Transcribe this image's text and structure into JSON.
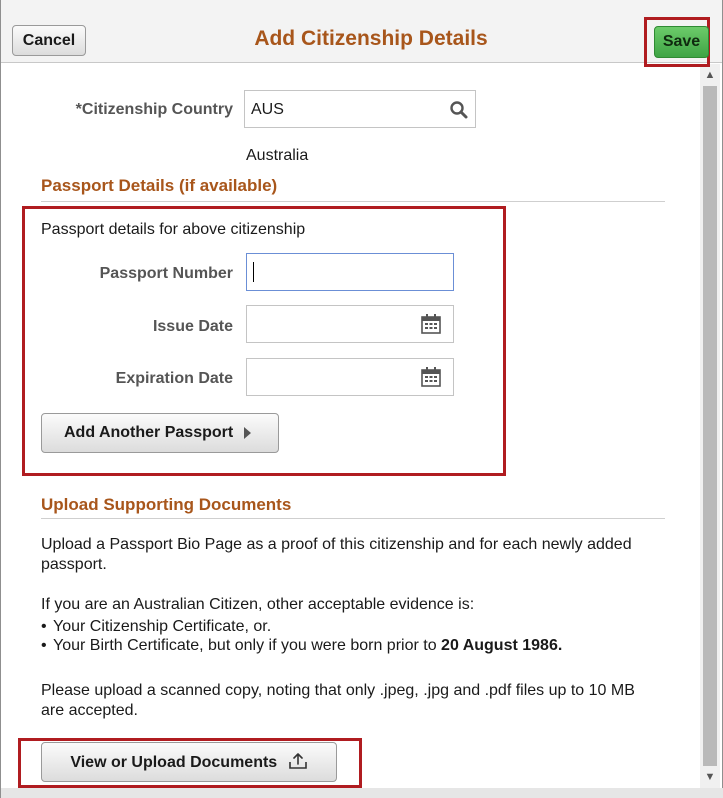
{
  "header": {
    "cancel_label": "Cancel",
    "title": "Add Citizenship Details",
    "save_label": "Save"
  },
  "citizenship": {
    "label": "*Citizenship Country",
    "value": "AUS",
    "description": "Australia"
  },
  "passport": {
    "section_title": "Passport Details (if available)",
    "intro": "Passport details for above citizenship",
    "number_label": "Passport Number",
    "number_value": "",
    "issue_label": "Issue Date",
    "expiration_label": "Expiration Date",
    "add_button_label": "Add Another Passport"
  },
  "upload": {
    "section_title": "Upload Supporting Documents",
    "para1": "Upload a Passport Bio Page as a proof of this citizenship and for each newly added passport.",
    "para2": "If you are an Australian Citizen, other acceptable evidence is:",
    "bullets": [
      "Your Citizenship Certificate, or.",
      "Your Birth Certificate, but only if you were born prior to "
    ],
    "bullet2_bold": "20 August 1986.",
    "para3": "Please upload a scanned copy, noting that only .jpeg, .jpg and .pdf files up to 10 MB are accepted.",
    "button_label": "View or Upload Documents"
  },
  "colors": {
    "title": "#a8561b",
    "save_button": "#4cb350",
    "highlight_box": "#b01c20"
  }
}
